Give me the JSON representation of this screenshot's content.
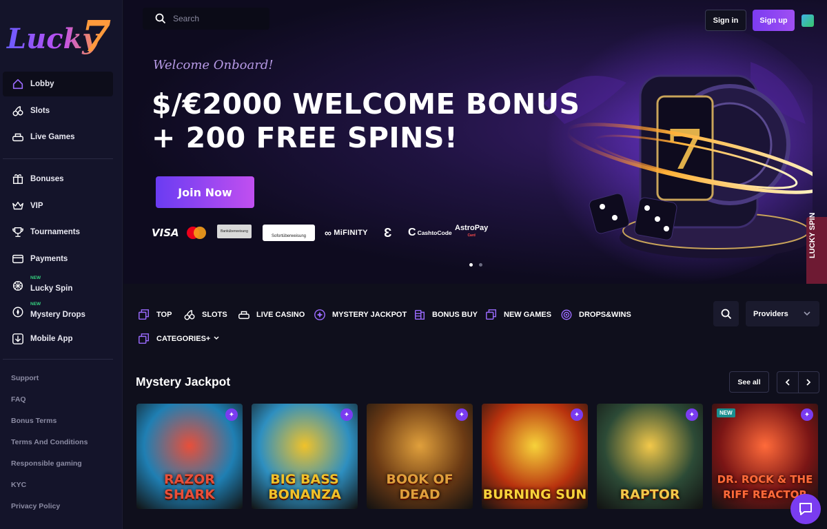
{
  "brand": {
    "logo_text": "Lucky",
    "logo_seven": "7"
  },
  "sidebar": {
    "primary": [
      {
        "label": "Lobby",
        "icon": "home-icon",
        "active": true
      },
      {
        "label": "Slots",
        "icon": "cherries-icon"
      },
      {
        "label": "Live Games",
        "icon": "dealer-table-icon"
      }
    ],
    "secondary": [
      {
        "label": "Bonuses",
        "icon": "gift-icon"
      },
      {
        "label": "VIP",
        "icon": "crown-icon"
      },
      {
        "label": "Tournaments",
        "icon": "trophy-icon"
      },
      {
        "label": "Payments",
        "icon": "card-icon"
      },
      {
        "label": "Lucky Spin",
        "icon": "wheel-icon",
        "badge": "NEW"
      },
      {
        "label": "Mystery Drops",
        "icon": "drop-target-icon",
        "badge": "NEW"
      },
      {
        "label": "Mobile App",
        "icon": "download-icon"
      }
    ],
    "footer_links": [
      "Support",
      "FAQ",
      "Bonus Terms",
      "Terms And Conditions",
      "Responsible gaming",
      "KYC",
      "Privacy Policy"
    ]
  },
  "header": {
    "search_placeholder": "Search",
    "signin": "Sign in",
    "signup": "Sign up"
  },
  "hero": {
    "welcome": "Welcome Onboard!",
    "headline_1": "$/€2000 WELCOME BONUS",
    "headline_2": "+ 200 FREE SPINS!",
    "cta": "Join Now",
    "payments": {
      "visa": "VISA",
      "bank": "Banküberweisung",
      "sofort": "Sofortüberweisung",
      "mifinity": "MiFINITY",
      "cashtocode": "CashtoCode",
      "astropay": "AstroPay",
      "astropay_sub": "Card"
    },
    "slides": 2,
    "active_slide": 1
  },
  "lucky_spin_tab": "LUCKY SPIN",
  "categories": [
    {
      "label": "TOP",
      "icon": "square-stack-icon"
    },
    {
      "label": "SLOTS",
      "icon": "cherries-icon"
    },
    {
      "label": "LIVE CASINO",
      "icon": "dealer-table-icon"
    },
    {
      "label": "MYSTERY JACKPOT",
      "icon": "sparkle-circle-icon"
    },
    {
      "label": "BONUS BUY",
      "icon": "coins-icon"
    },
    {
      "label": "NEW GAMES",
      "icon": "square-stack-icon"
    },
    {
      "label": "DROPS&WINS",
      "icon": "target-icon"
    },
    {
      "label": "CATEGORIES+",
      "icon": "square-stack-icon"
    }
  ],
  "providers_label": "Providers",
  "section": {
    "title": "Mystery Jackpot",
    "see_all": "See all"
  },
  "games": [
    {
      "title": "RAZOR SHARK",
      "bg": "#1f7fb3",
      "accent": "#e84f3a"
    },
    {
      "title": "BIG BASS BONANZA",
      "bg": "#2e8fc0",
      "accent": "#f0c22a"
    },
    {
      "title": "BOOK OF DEAD",
      "bg": "#6b3a14",
      "accent": "#e0a03c"
    },
    {
      "title": "BURNING SUN",
      "bg": "#b8320e",
      "accent": "#f7d23a"
    },
    {
      "title": "RAPTOR",
      "bg": "#2c4a36",
      "accent": "#f2c84a"
    },
    {
      "title": "DR. ROCK & THE RIFF REACTOR",
      "bg": "#7a1515",
      "accent": "#ff6a3a",
      "badge": "NEW"
    }
  ]
}
